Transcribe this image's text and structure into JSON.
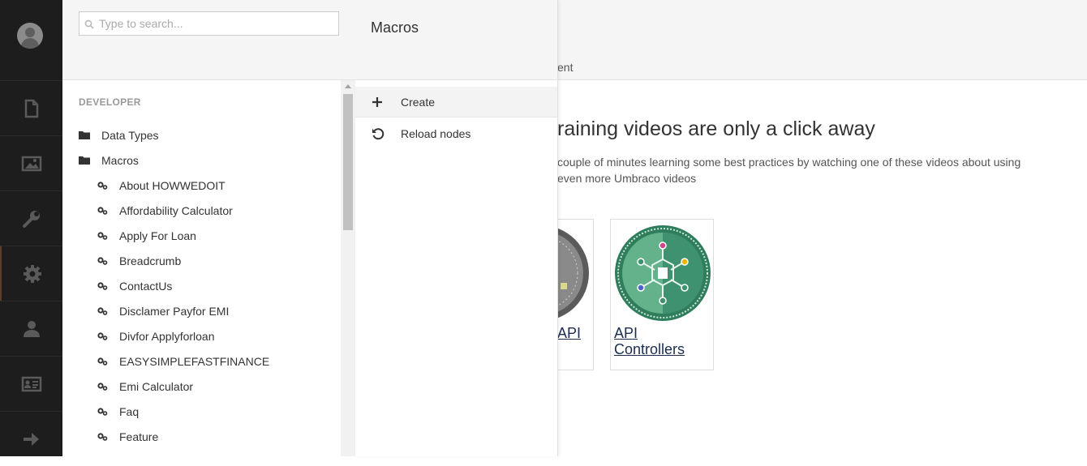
{
  "rail": {
    "sections": [
      {
        "name": "content",
        "icon": "document-icon"
      },
      {
        "name": "media",
        "icon": "image-icon"
      },
      {
        "name": "settings",
        "icon": "wrench-icon"
      },
      {
        "name": "developer",
        "icon": "gear-icon",
        "active": true
      },
      {
        "name": "users",
        "icon": "user-icon"
      },
      {
        "name": "members",
        "icon": "id-card-icon"
      },
      {
        "name": "forms",
        "icon": "arrow-right-icon"
      }
    ]
  },
  "tree": {
    "search_placeholder": "Type to search...",
    "section_title": "DEVELOPER",
    "folders": [
      "Data Types",
      "Macros"
    ],
    "macros": [
      "About HOWWEDOIT",
      "Affordability Calculator",
      "Apply For Loan",
      "Breadcrumb",
      "ContactUs",
      "Disclamer Payfor EMI",
      "Divfor Applyforloan",
      "EASYSIMPLEFASTFINANCE",
      "Emi Calculator",
      "Faq",
      "Feature"
    ]
  },
  "actions": {
    "title": "Macros",
    "items": [
      {
        "label": "Create",
        "icon": "plus-icon"
      },
      {
        "label": "Reload nodes",
        "icon": "reload-icon"
      }
    ]
  },
  "dashboard": {
    "tab_partial": "ent",
    "title": "raining videos are only a click away",
    "text_line1": "couple of minutes learning some best practices by watching one of these videos about using",
    "text_line2": "even more Umbraco videos",
    "cards": [
      {
        "label": "API"
      },
      {
        "label": "API Controllers"
      }
    ]
  }
}
